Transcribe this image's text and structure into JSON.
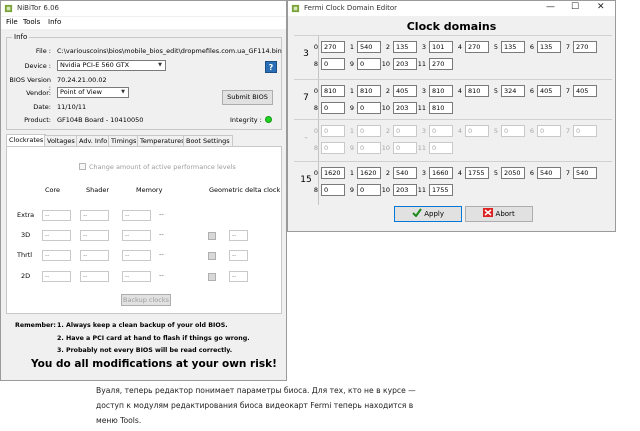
{
  "nibitor": {
    "title": "NiBiTor 6.06",
    "menu": [
      "File",
      "Tools",
      "Info"
    ],
    "info_group": "Info",
    "file_label": "File :",
    "file_value": "C:\\variouscoins\\bios\\mobile_bios_edit\\dropmefiles.com.ua_GF114.bin",
    "device_label": "Device :",
    "device_value": "Nvidia PCI-E 560 GTX",
    "bios_label": "BIOS Version :",
    "bios_value": "70.24.21.00.02",
    "vendor_label": "Vendor:",
    "vendor_value": "Point of View",
    "date_label": "Date:",
    "date_value": "11/10/11",
    "product_label": "Product:",
    "product_value": "GF104B Board - 10410050",
    "help_label": "?",
    "submit_label": "Submit BIOS",
    "integrity_label": "Integrity :",
    "integrity_color": "#22d322",
    "tabs": [
      "Clockrates",
      "Voltages",
      "Adv. Info",
      "Timings",
      "Temperatures",
      "Boot Settings"
    ],
    "clock": {
      "checkbox_label": "Change amount of active performance levels",
      "col_core": "Core",
      "col_shader": "Shader",
      "col_memory": "Memory",
      "col_geo": "Geometric delta clock",
      "rows": [
        "Extra",
        "3D",
        "Thrtl",
        "2D"
      ],
      "placeholder": "--",
      "backup_label": "Backup clocks"
    },
    "remember_label": "Remember:",
    "remember_lines": [
      "1. Always keep a clean backup of your old BIOS.",
      "2. Have a PCI card at hand to flash if things go wrong.",
      "3. Probably not every BIOS will be read correctly."
    ],
    "risk": "You do all modifications at your own risk!"
  },
  "fermi": {
    "title": "Fermi Clock Domain Editor",
    "heading": "Clock domains",
    "win_min": "—",
    "win_max": "☐",
    "win_close": "✕",
    "rows": [
      {
        "name": "3",
        "disabled": false,
        "line1": [
          [
            "0",
            "270"
          ],
          [
            "1",
            "540"
          ],
          [
            "2",
            "135"
          ],
          [
            "3",
            "101"
          ],
          [
            "4",
            "270"
          ],
          [
            "5",
            "135"
          ],
          [
            "6",
            "135"
          ],
          [
            "7",
            "270"
          ]
        ],
        "line2": [
          [
            "8",
            "0"
          ],
          [
            "9",
            "0"
          ],
          [
            "10",
            "203"
          ],
          [
            "11",
            "270"
          ]
        ]
      },
      {
        "name": "7",
        "disabled": false,
        "line1": [
          [
            "0",
            "810"
          ],
          [
            "1",
            "810"
          ],
          [
            "2",
            "405"
          ],
          [
            "3",
            "810"
          ],
          [
            "4",
            "810"
          ],
          [
            "5",
            "324"
          ],
          [
            "6",
            "405"
          ],
          [
            "7",
            "405"
          ]
        ],
        "line2": [
          [
            "8",
            "0"
          ],
          [
            "9",
            "0"
          ],
          [
            "10",
            "203"
          ],
          [
            "11",
            "810"
          ]
        ]
      },
      {
        "name": "-",
        "disabled": true,
        "line1": [
          [
            "0",
            "0"
          ],
          [
            "1",
            "0"
          ],
          [
            "2",
            "0"
          ],
          [
            "3",
            "0"
          ],
          [
            "4",
            "0"
          ],
          [
            "5",
            "0"
          ],
          [
            "6",
            "0"
          ],
          [
            "7",
            "0"
          ]
        ],
        "line2": [
          [
            "8",
            "0"
          ],
          [
            "9",
            "0"
          ],
          [
            "10",
            "0"
          ],
          [
            "11",
            "0"
          ]
        ]
      },
      {
        "name": "15",
        "disabled": false,
        "line1": [
          [
            "0",
            "1620"
          ],
          [
            "1",
            "1620"
          ],
          [
            "2",
            "540"
          ],
          [
            "3",
            "1660"
          ],
          [
            "4",
            "1755"
          ],
          [
            "5",
            "2050"
          ],
          [
            "6",
            "540"
          ],
          [
            "7",
            "540"
          ]
        ],
        "line2": [
          [
            "8",
            "0"
          ],
          [
            "9",
            "0"
          ],
          [
            "10",
            "203"
          ],
          [
            "11",
            "1755"
          ]
        ]
      }
    ],
    "apply_label": "Apply",
    "abort_label": "Abort"
  },
  "caption": "Вуаля, теперь редактор понимает параметры биоса. Для тех, кто не в курсе — доступ к модулям редактирования биоса видеокарт Fermi теперь находится в меню Tools."
}
